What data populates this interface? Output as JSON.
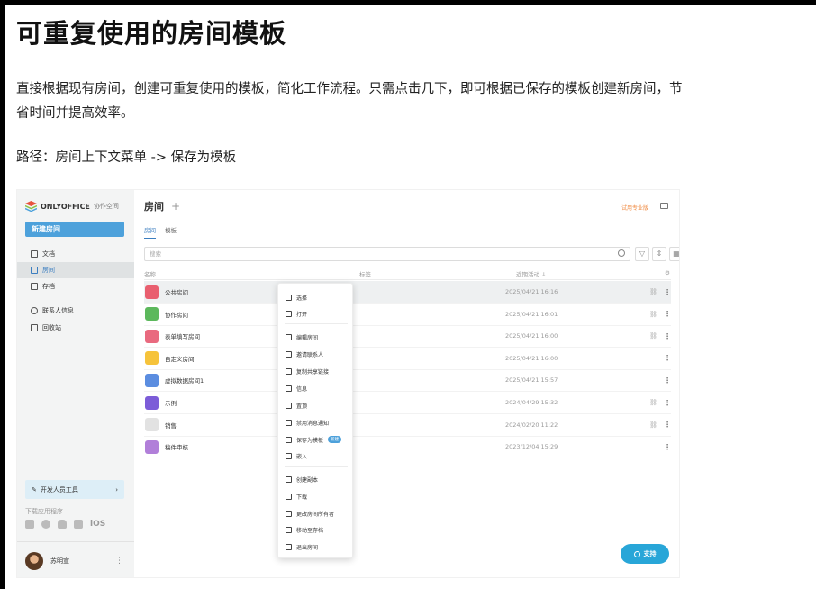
{
  "article": {
    "heading": "可重复使用的房间模板",
    "paragraph": "直接根据现有房间，创建可重复使用的模板，简化工作流程。只需点击几下，即可根据已保存的模板创建新房间，节省时间并提高效率。",
    "path": "路径：房间上下文菜单 -> 保存为模板"
  },
  "app": {
    "logo_text": "ONLYOFFICE",
    "logo_sub": "协作空间",
    "new_room_button": "新建房间",
    "nav": [
      {
        "label": "文档",
        "icon": "document-icon"
      },
      {
        "label": "房间",
        "icon": "rooms-icon",
        "active": true
      },
      {
        "label": "存档",
        "icon": "archive-icon"
      },
      {
        "label": "联系人信息",
        "icon": "contacts-icon"
      },
      {
        "label": "回收站",
        "icon": "trash-icon"
      }
    ],
    "dev_tools": "开发人员工具",
    "download_label": "下载应用程序",
    "download_ios": "iOS",
    "user_name": "苏明宣",
    "page_title": "房间",
    "trial_link": "试用专业版",
    "tabs": [
      "房间",
      "模板"
    ],
    "search_placeholder": "搜索",
    "columns": {
      "name": "名称",
      "tags": "标签",
      "activity": "近期活动 ↓"
    },
    "rows": [
      {
        "name": "公共房间",
        "date": "2025/04/21 16:16",
        "color": "#e95f6f",
        "link": true
      },
      {
        "name": "协作房间",
        "date": "2025/04/21 16:01",
        "color": "#5cb85c",
        "link": true
      },
      {
        "name": "表单填写房间",
        "date": "2025/04/21 16:00",
        "color": "#e96a7f",
        "link": true
      },
      {
        "name": "自定义房间",
        "date": "2025/04/21 16:00",
        "color": "#f6c33b",
        "link": false
      },
      {
        "name": "虚拟数据房间1",
        "date": "2025/04/21 15:57",
        "color": "#5b8de0",
        "link": false
      },
      {
        "name": "示例",
        "date": "2024/04/29 15:32",
        "color": "#7c5cd8",
        "link": true
      },
      {
        "name": "销售",
        "date": "2024/02/20 11:22",
        "color": "#e2e2e2",
        "link": true
      },
      {
        "name": "稿件审核",
        "date": "2023/12/04 15:29",
        "color": "#b17fd9",
        "link": false
      }
    ],
    "context_menu": [
      {
        "label": "选择",
        "icon": "select-icon"
      },
      {
        "label": "打开",
        "icon": "folder-open-icon"
      },
      {
        "label": "编辑房间",
        "icon": "edit-room-icon"
      },
      {
        "label": "邀请联系人",
        "icon": "invite-icon"
      },
      {
        "label": "复制共享链接",
        "icon": "link-icon"
      },
      {
        "label": "信息",
        "icon": "info-icon"
      },
      {
        "label": "置顶",
        "icon": "pin-icon"
      },
      {
        "label": "禁用消息通知",
        "icon": "mute-icon"
      },
      {
        "label": "保存为模板",
        "icon": "template-icon",
        "badge": "新建"
      },
      {
        "label": "嵌入",
        "icon": "embed-icon"
      },
      {
        "label": "创建副本",
        "icon": "copy-icon"
      },
      {
        "label": "下载",
        "icon": "download-icon"
      },
      {
        "label": "更改房间所有者",
        "icon": "owner-icon"
      },
      {
        "label": "移动至存档",
        "icon": "archive-move-icon"
      },
      {
        "label": "退出房间",
        "icon": "leave-icon"
      }
    ],
    "support_button": "支持"
  }
}
